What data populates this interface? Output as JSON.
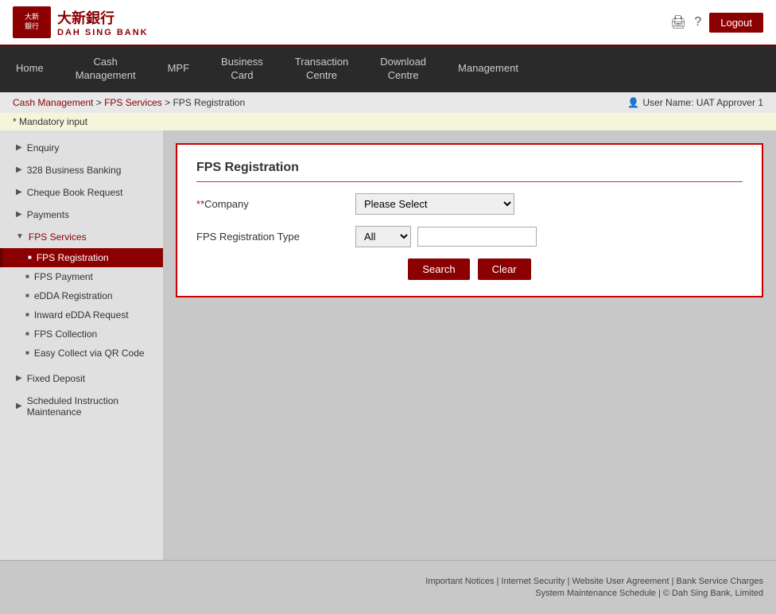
{
  "header": {
    "logo_alt": "Dah Sing Bank",
    "logo_chinese": "大新銀行",
    "logout_label": "Logout"
  },
  "nav": {
    "items": [
      {
        "id": "home",
        "label": "Home"
      },
      {
        "id": "cash-management",
        "label": "Cash\nManagement"
      },
      {
        "id": "mpf",
        "label": "MPF"
      },
      {
        "id": "business-card",
        "label": "Business\nCard"
      },
      {
        "id": "transaction-centre",
        "label": "Transaction\nCentre"
      },
      {
        "id": "download-centre",
        "label": "Download\nCentre"
      },
      {
        "id": "management",
        "label": "Management"
      }
    ]
  },
  "breadcrumb": {
    "text": "Cash Management > FPS Services > FPS Registration",
    "links": [
      "Cash Management",
      "FPS Services",
      "FPS Registration"
    ]
  },
  "user": {
    "label": "User Name: UAT Approver 1"
  },
  "mandatory_notice": "* Mandatory input",
  "sidebar": {
    "items": [
      {
        "id": "enquiry",
        "label": "Enquiry",
        "type": "parent",
        "arrow": "▶"
      },
      {
        "id": "328-business",
        "label": "328 Business Banking",
        "type": "parent",
        "arrow": "▶"
      },
      {
        "id": "cheque-book",
        "label": "Cheque Book Request",
        "type": "parent",
        "arrow": "▶"
      },
      {
        "id": "payments",
        "label": "Payments",
        "type": "parent",
        "arrow": "▶"
      },
      {
        "id": "fps-services",
        "label": "FPS Services",
        "type": "parent-open",
        "arrow": "▼"
      },
      {
        "id": "fps-registration",
        "label": "FPS Registration",
        "type": "sub-active"
      },
      {
        "id": "fps-payment",
        "label": "FPS Payment",
        "type": "sub"
      },
      {
        "id": "edda-registration",
        "label": "eDDA Registration",
        "type": "sub"
      },
      {
        "id": "inward-edda",
        "label": "Inward eDDA Request",
        "type": "sub"
      },
      {
        "id": "fps-collection",
        "label": "FPS Collection",
        "type": "sub"
      },
      {
        "id": "easy-collect",
        "label": "Easy Collect via QR Code",
        "type": "sub"
      },
      {
        "id": "fixed-deposit",
        "label": "Fixed Deposit",
        "type": "parent",
        "arrow": "▶"
      },
      {
        "id": "scheduled-instruction",
        "label": "Scheduled Instruction Maintenance",
        "type": "parent",
        "arrow": "▶"
      }
    ]
  },
  "form": {
    "title": "FPS Registration",
    "company_label": "*Company",
    "company_placeholder": "Please Select",
    "company_options": [
      {
        "value": "",
        "label": "Please Select"
      }
    ],
    "type_label": "FPS Registration Type",
    "type_options": [
      {
        "value": "all",
        "label": "All"
      }
    ],
    "search_label": "Search",
    "clear_label": "Clear"
  },
  "footer": {
    "line1": "Important Notices | Internet Security | Website User Agreement | Bank Service Charges",
    "line2": "System Maintenance Schedule | © Dah Sing Bank, Limited"
  }
}
